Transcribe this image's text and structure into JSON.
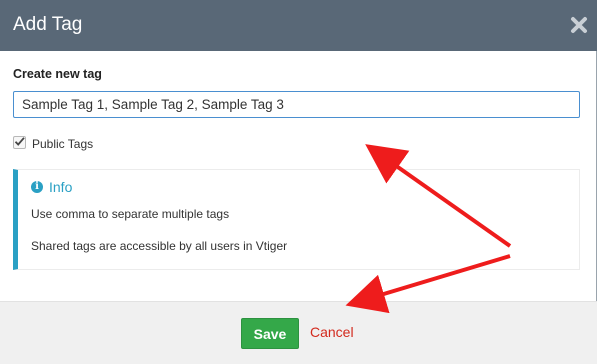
{
  "modal": {
    "title": "Add Tag",
    "close_icon": "close-icon"
  },
  "form": {
    "label": "Create new tag",
    "tag_input_value": "Sample Tag 1, Sample Tag 2, Sample Tag 3",
    "public_tags_label": "Public Tags",
    "public_tags_checked": true
  },
  "info": {
    "icon": "info-circle-icon",
    "title": "Info",
    "line1": "Use comma to separate multiple tags",
    "line2": "Shared tags are accessible by all users in Vtiger"
  },
  "footer": {
    "save_label": "Save",
    "cancel_label": "Cancel"
  },
  "colors": {
    "header_bg": "#596877",
    "info_accent": "#2aa0c4",
    "save_green": "#34a849",
    "cancel_red": "#d32a1e",
    "annotation_arrow": "#ee1c1c"
  }
}
